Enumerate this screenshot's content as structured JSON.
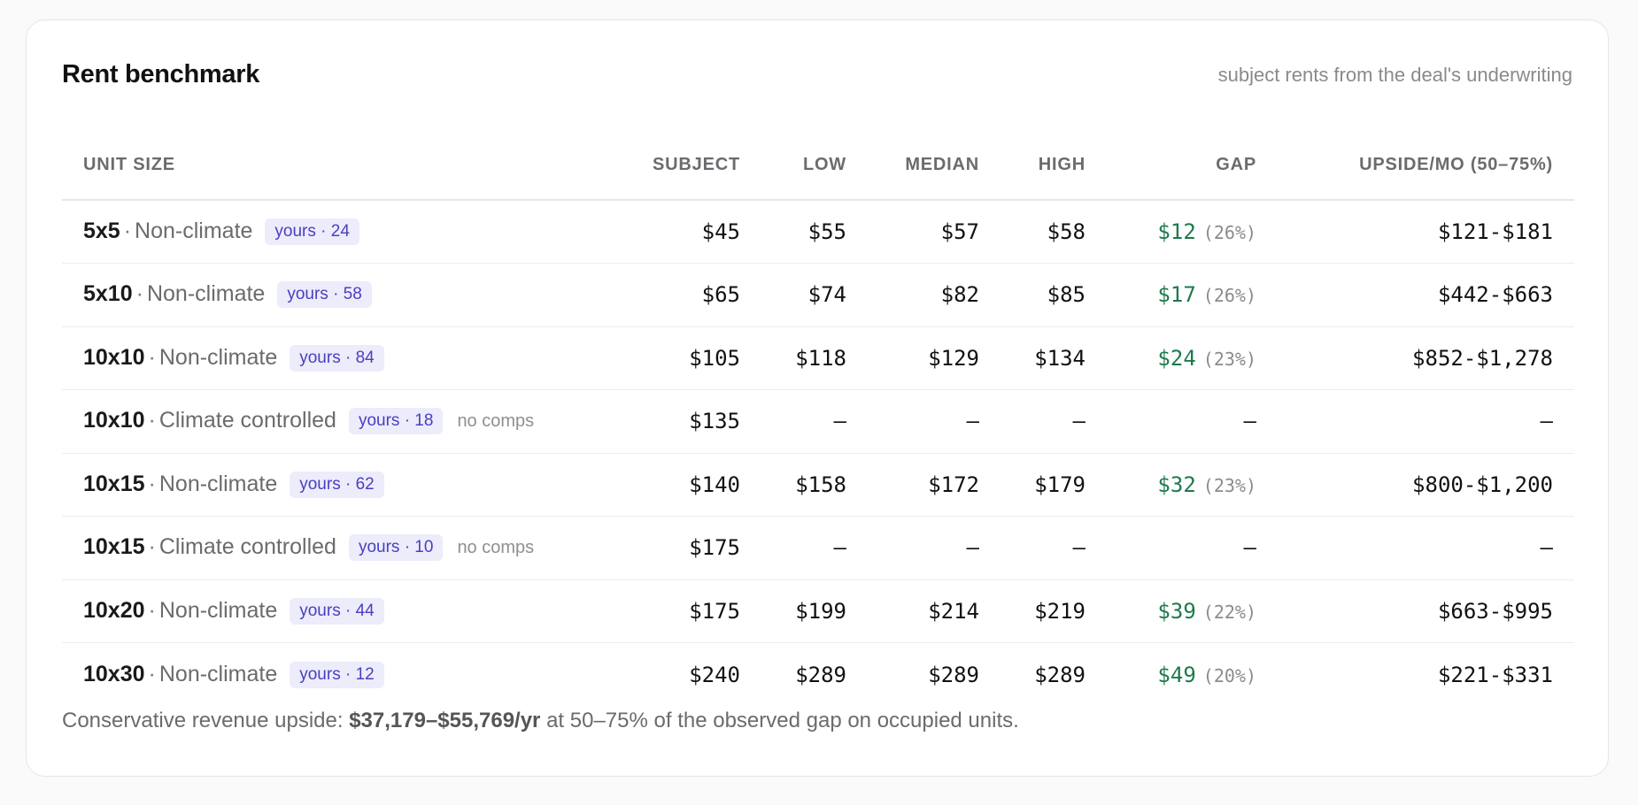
{
  "card": {
    "title": "Rent benchmark",
    "subtitle": "subject rents from the deal's underwriting"
  },
  "table": {
    "headers": {
      "unit_size": "UNIT SIZE",
      "subject": "SUBJECT",
      "low": "LOW",
      "median": "MEDIAN",
      "high": "HIGH",
      "gap": "GAP",
      "upside": "UPSIDE/MO (50–75%)"
    },
    "separator": "·",
    "rows": [
      {
        "size": "5x5",
        "type": "Non-climate",
        "badge": "yours · 24",
        "note": "",
        "subject": "$45",
        "low": "$55",
        "median": "$57",
        "high": "$58",
        "gap_amount": "$12",
        "gap_pct": "(26%)",
        "upside": "$121-$181"
      },
      {
        "size": "5x10",
        "type": "Non-climate",
        "badge": "yours · 58",
        "note": "",
        "subject": "$65",
        "low": "$74",
        "median": "$82",
        "high": "$85",
        "gap_amount": "$17",
        "gap_pct": "(26%)",
        "upside": "$442-$663"
      },
      {
        "size": "10x10",
        "type": "Non-climate",
        "badge": "yours · 84",
        "note": "",
        "subject": "$105",
        "low": "$118",
        "median": "$129",
        "high": "$134",
        "gap_amount": "$24",
        "gap_pct": "(23%)",
        "upside": "$852-$1,278"
      },
      {
        "size": "10x10",
        "type": "Climate controlled",
        "badge": "yours · 18",
        "note": "no comps",
        "subject": "$135",
        "low": "–",
        "median": "–",
        "high": "–",
        "gap_amount": "–",
        "gap_pct": "",
        "upside": "–"
      },
      {
        "size": "10x15",
        "type": "Non-climate",
        "badge": "yours · 62",
        "note": "",
        "subject": "$140",
        "low": "$158",
        "median": "$172",
        "high": "$179",
        "gap_amount": "$32",
        "gap_pct": "(23%)",
        "upside": "$800-$1,200"
      },
      {
        "size": "10x15",
        "type": "Climate controlled",
        "badge": "yours · 10",
        "note": "no comps",
        "subject": "$175",
        "low": "–",
        "median": "–",
        "high": "–",
        "gap_amount": "–",
        "gap_pct": "",
        "upside": "–"
      },
      {
        "size": "10x20",
        "type": "Non-climate",
        "badge": "yours · 44",
        "note": "",
        "subject": "$175",
        "low": "$199",
        "median": "$214",
        "high": "$219",
        "gap_amount": "$39",
        "gap_pct": "(22%)",
        "upside": "$663-$995"
      },
      {
        "size": "10x30",
        "type": "Non-climate",
        "badge": "yours · 12",
        "note": "",
        "subject": "$240",
        "low": "$289",
        "median": "$289",
        "high": "$289",
        "gap_amount": "$49",
        "gap_pct": "(20%)",
        "upside": "$221-$331"
      }
    ]
  },
  "footer": {
    "prefix": "Conservative revenue upside: ",
    "highlight": "$37,179–$55,769/yr",
    "suffix": " at 50–75% of the observed gap on occupied units."
  },
  "colors": {
    "gap_positive": "#1d7a4a",
    "badge_bg": "#ececfb",
    "badge_text": "#4a3fc0"
  }
}
